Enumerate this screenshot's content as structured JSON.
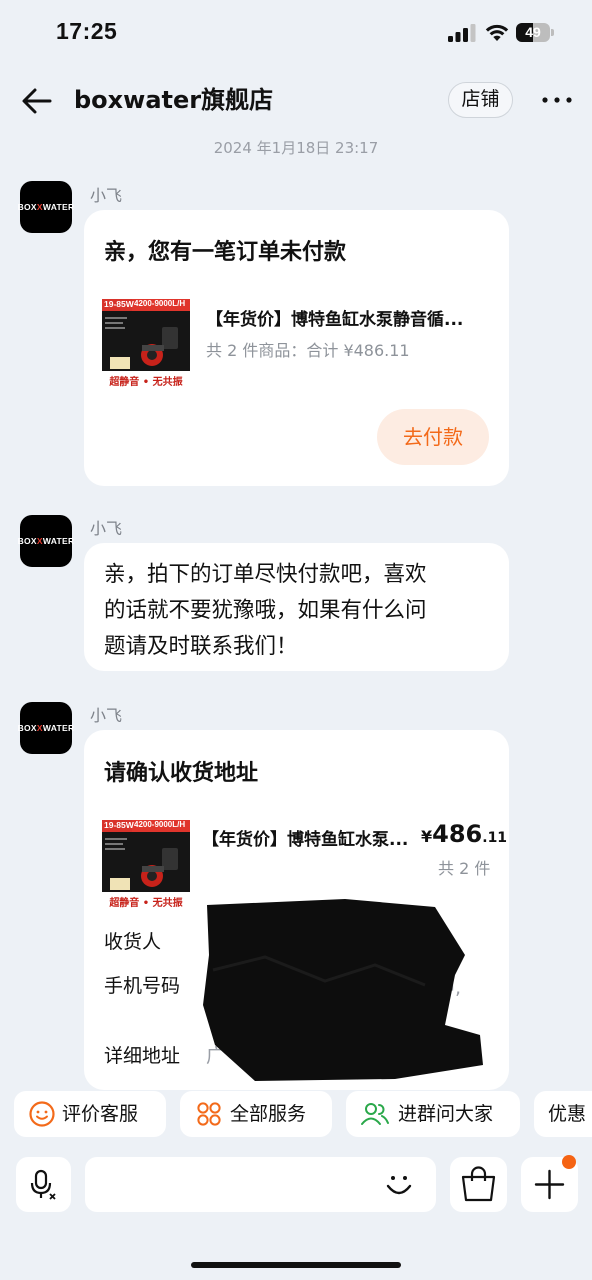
{
  "status_bar": {
    "time": "17:25",
    "battery": "49",
    "battery_level": 0.49
  },
  "header": {
    "title": "boxwater旗舰店",
    "shop_button": "店铺"
  },
  "chat": {
    "timestamp": "2024 年1月18日 23:17",
    "brand_logo": {
      "left": "BOX",
      "mid": "X",
      "right": "WATER"
    },
    "messages": [
      {
        "sender": "小飞",
        "title": "亲，您有一笔订单未付款",
        "product": {
          "name": "【年货价】博特鱼缸水泵静音循...",
          "summary": "共 2 件商品：合计 ¥486.11",
          "thumb_top": "19-85W",
          "thumb_flow": "4200-9000L/H",
          "thumb_caption": "超静音 • 无共振"
        },
        "action": "去付款"
      },
      {
        "sender": "小飞",
        "text_lines": [
          "亲，拍下的订单尽快付款吧，喜欢",
          "的话就不要犹豫哦，如果有什么问",
          "题请及时联系我们！"
        ]
      },
      {
        "sender": "小飞",
        "title": "请确认收货地址",
        "product": {
          "name": "【年货价】博特鱼缸水泵...",
          "price_symbol": "¥",
          "price_int": "486",
          "price_dec": ".11",
          "qty": "共 2 件",
          "thumb_top": "19-85W",
          "thumb_flow": "4200-9000L/H",
          "thumb_caption": "超静音 • 无共振"
        },
        "fields": {
          "receiver": "收货人",
          "phone": "手机号码",
          "address": "详细地址",
          "visible_fragments": [
            "中,",
            "广"
          ]
        }
      }
    ]
  },
  "quick_actions": [
    "评价客服",
    "全部服务",
    "进群问大家",
    "优惠"
  ],
  "colors": {
    "accent": "#f36a1a",
    "bg": "#edf1f6",
    "green": "#2aa84a"
  }
}
